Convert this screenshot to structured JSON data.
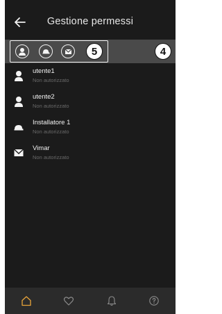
{
  "header": {
    "title": "Gestione permessi",
    "back_icon": "arrow-left-icon"
  },
  "filters": {
    "items": [
      {
        "icon": "user-icon"
      },
      {
        "icon": "installer-cap-icon"
      },
      {
        "icon": "vimar-envelope-icon"
      }
    ],
    "annotation_box": "5",
    "annotation_bar": "4"
  },
  "users": [
    {
      "name": "utente1",
      "status": "Non autorizzato",
      "icon": "user-icon"
    },
    {
      "name": "utente2",
      "status": "Non autorizzato",
      "icon": "user-icon"
    },
    {
      "name": "Installatore 1",
      "status": "Non autorizzato",
      "icon": "installer-cap-icon"
    },
    {
      "name": "Vimar",
      "status": "Non autorizzato",
      "icon": "vimar-envelope-icon"
    }
  ],
  "tabbar": {
    "items": [
      {
        "icon": "home-icon",
        "active": true
      },
      {
        "icon": "heart-icon",
        "active": false
      },
      {
        "icon": "bell-icon",
        "active": false
      },
      {
        "icon": "help-icon",
        "active": false
      }
    ]
  },
  "colors": {
    "accent": "#e8a43a",
    "background": "#1b1b1b",
    "filter_bar": "#4a4a4a",
    "tab_bar": "#2b2b2b"
  }
}
